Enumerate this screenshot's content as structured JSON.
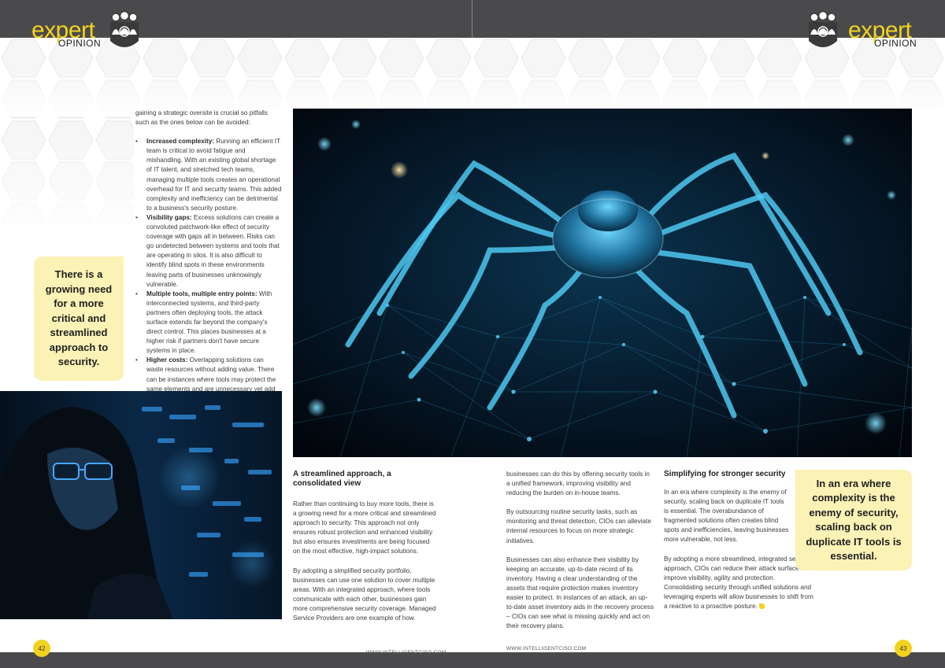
{
  "header": {
    "logo_word": "expert",
    "logo_sub": "OPINION"
  },
  "left_page": {
    "intro": "gaining a strategic oversite is crucial so pitfalls such as the ones below can be avoided:",
    "bullets": [
      {
        "term": "Increased complexity:",
        "text": " Running an efficient IT team is critical to avoid fatigue and mishandling. With an existing global shortage of IT talent, and stretched tech teams, managing multiple tools creates an operational overhead for IT and security teams. This added complexity and inefficiency can be detrimental to a business's security posture."
      },
      {
        "term": "Visibility gaps:",
        "text": " Excess solutions can create a convoluted patchwork-like effect of security coverage with gaps all in between. Risks can go undetected between systems and tools that are operating in silos. It is also difficult to identify blind spots in these environments leaving parts of businesses unknowingly vulnerable."
      },
      {
        "term": "Multiple tools, multiple entry points:",
        "text": " With interconnected systems, and third-party partners often deploying tools, the attack surface extends far beyond the company's direct control. This places businesses at a higher risk if partners don't have secure systems in place."
      },
      {
        "term": "Higher costs:",
        "text": " Overlapping solutions can waste resources without adding value. There can be instances where tools may protect the same elements and are unnecessary yet add to business costs."
      }
    ],
    "pull_quote": "There is a growing need for a more critical and streamlined approach to security.",
    "page_number": "42",
    "url": "WWW.INTELLIGENTCISO.COM"
  },
  "section1": {
    "heading": "A streamlined approach, a consolidated view",
    "paragraphs": [
      "Rather than continuing to buy more tools, there is a growing need for a more critical and streamlined approach to security. This approach not only ensures robust protection and enhanced visibility but also ensures investments are being focused on the most effective, high-impact solutions.",
      "By adopting a simplified security portfolio, businesses can use one solution to cover multiple areas. With an integrated approach, where tools communicate with each other, businesses gain more comprehensive security coverage. Managed Service Providers are one example of how"
    ]
  },
  "column2": {
    "paragraphs": [
      "businesses can do this by offering security tools in a unified framework, improving visibility and reducing the burden on in-house teams.",
      "By outsourcing routine security tasks, such as monitoring and threat detection, CIOs can alleviate internal resources to focus on more strategic initiatives.",
      "Businesses can also enhance their visibility by keeping an accurate, up-to-date record of its inventory. Having a clear understanding of the assets that require protection makes inventory easier to protect. In instances of an attack, an up-to-date asset inventory aids in the recovery process – CIOs can see what is missing quickly and act on their recovery plans."
    ]
  },
  "section3": {
    "heading": "Simplifying for stronger security",
    "paragraphs": [
      "In an era where complexity is the enemy of security, scaling back on duplicate IT tools is essential. The overabundance of fragmented solutions often creates blind spots and inefficiencies, leaving businesses more vulnerable, not less.",
      "By adopting a more streamlined, integrated security approach, CIOs can reduce their attack surface and improve visibility, agility and protection. Consolidating security through unified solutions and leveraging experts will allow businesses to shift from a reactive to a proactive posture."
    ]
  },
  "right_page": {
    "pull_quote": "In an era where complexity is the enemy of security, scaling back on duplicate IT tools is essential.",
    "page_number": "43",
    "url": "WWW.INTELLIGENTCISO.COM"
  },
  "colors": {
    "accent_yellow": "#f2d21e",
    "pull_quote_bg": "#fbf2b6",
    "bar_gray": "#4a4a4c"
  },
  "icons": [
    "team-emblem-icon",
    "end-mark-icon"
  ]
}
